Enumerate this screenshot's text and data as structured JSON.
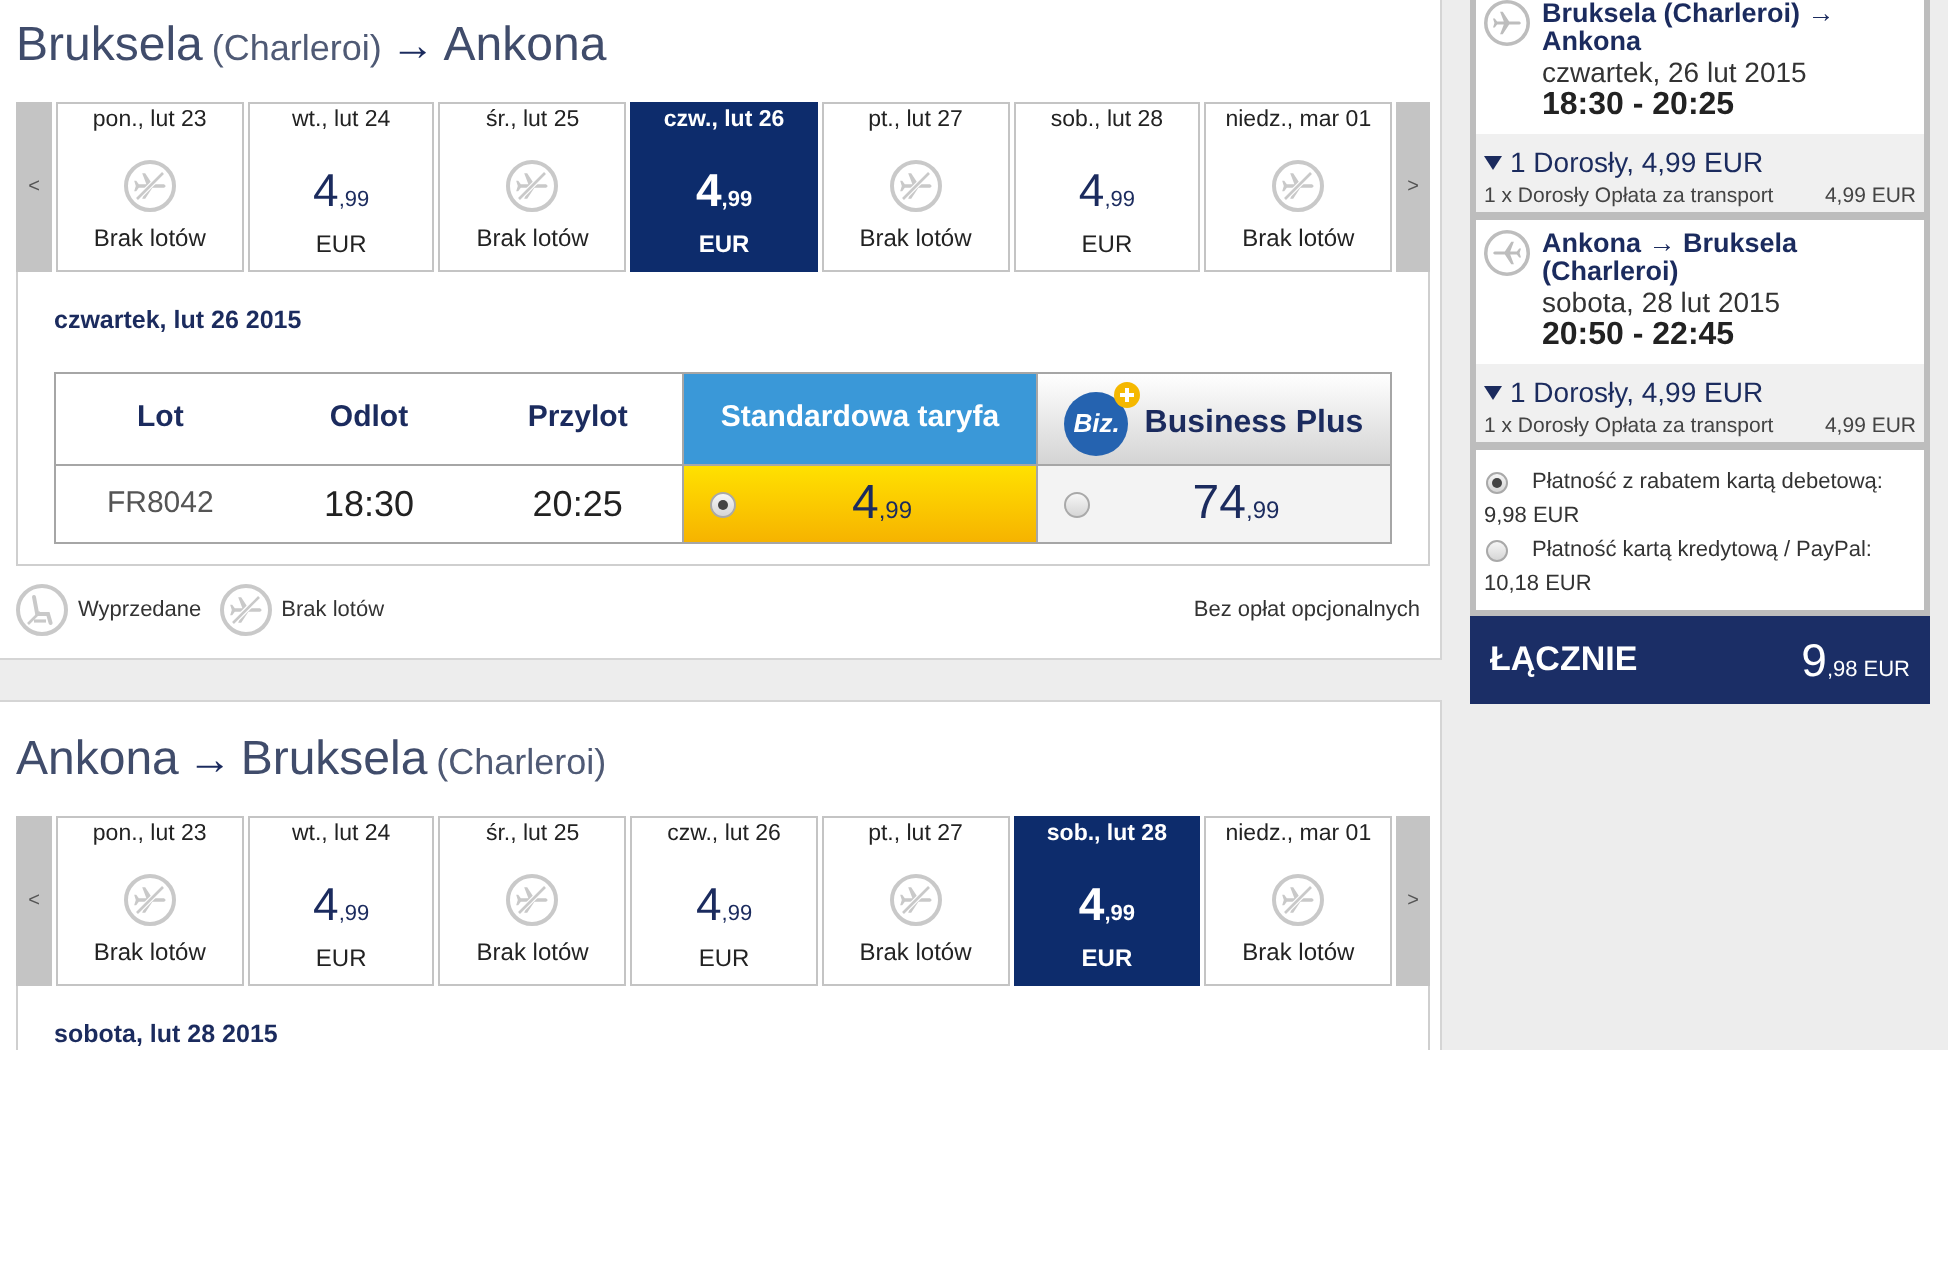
{
  "journeys": [
    {
      "title": [
        {
          "kind": "city",
          "text": "Bruksela"
        },
        {
          "kind": "note",
          "text": "(Charleroi)"
        },
        {
          "kind": "arrow",
          "text": "→"
        },
        {
          "kind": "city",
          "text": "Ankona"
        }
      ],
      "prev_label": "<",
      "next_label": ">",
      "days": [
        {
          "label": "pon., lut 23",
          "kind": "no_flights",
          "status": "Brak lotów",
          "selected": false
        },
        {
          "label": "wt., lut 24",
          "kind": "fare",
          "price": {
            "whole": "4",
            "fraction": ",99"
          },
          "currency": "EUR",
          "selected": false
        },
        {
          "label": "śr., lut 25",
          "kind": "no_flights",
          "status": "Brak lotów",
          "selected": false
        },
        {
          "label": "czw., lut 26",
          "kind": "fare",
          "price": {
            "whole": "4",
            "fraction": ",99"
          },
          "currency": "EUR",
          "selected": true
        },
        {
          "label": "pt., lut 27",
          "kind": "no_flights",
          "status": "Brak lotów",
          "selected": false
        },
        {
          "label": "sob., lut 28",
          "kind": "fare",
          "price": {
            "whole": "4",
            "fraction": ",99"
          },
          "currency": "EUR",
          "selected": false
        },
        {
          "label": "niedz., mar 01",
          "kind": "no_flights",
          "status": "Brak lotów",
          "selected": false
        }
      ],
      "date_heading": "czwartek, lut 26 2015",
      "table": {
        "columns": [
          {
            "kind": "text",
            "label": "Lot"
          },
          {
            "kind": "text",
            "label": "Odlot"
          },
          {
            "kind": "text",
            "label": "Przylot"
          },
          {
            "kind": "standard",
            "label": "Standardowa taryfa"
          },
          {
            "kind": "business",
            "label": "Business Plus",
            "logo": "Biz."
          }
        ],
        "rows": [
          {
            "cells": [
              "FR8042",
              "18:30",
              "20:25"
            ],
            "fares": [
              {
                "whole": "4",
                "fraction": ",99",
                "selected": true
              },
              {
                "whole": "74",
                "fraction": ",99",
                "selected": false
              }
            ]
          }
        ]
      },
      "legend": {
        "items": [
          {
            "kind": "sold_out",
            "label": "Wyprzedane"
          },
          {
            "kind": "no_flights",
            "label": "Brak lotów"
          }
        ],
        "note": "Bez opłat opcjonalnych"
      }
    },
    {
      "title": [
        {
          "kind": "city",
          "text": "Ankona"
        },
        {
          "kind": "arrow",
          "text": "→"
        },
        {
          "kind": "city",
          "text": "Bruksela"
        },
        {
          "kind": "note",
          "text": "(Charleroi)"
        }
      ],
      "prev_label": "<",
      "next_label": ">",
      "days": [
        {
          "label": "pon., lut 23",
          "kind": "no_flights",
          "status": "Brak lotów",
          "selected": false
        },
        {
          "label": "wt., lut 24",
          "kind": "fare",
          "price": {
            "whole": "4",
            "fraction": ",99"
          },
          "currency": "EUR",
          "selected": false
        },
        {
          "label": "śr., lut 25",
          "kind": "no_flights",
          "status": "Brak lotów",
          "selected": false
        },
        {
          "label": "czw., lut 26",
          "kind": "fare",
          "price": {
            "whole": "4",
            "fraction": ",99"
          },
          "currency": "EUR",
          "selected": false
        },
        {
          "label": "pt., lut 27",
          "kind": "no_flights",
          "status": "Brak lotów",
          "selected": false
        },
        {
          "label": "sob., lut 28",
          "kind": "fare",
          "price": {
            "whole": "4",
            "fraction": ",99"
          },
          "currency": "EUR",
          "selected": true
        },
        {
          "label": "niedz., mar 01",
          "kind": "no_flights",
          "status": "Brak lotów",
          "selected": false
        }
      ],
      "date_heading": "sobota, lut 28 2015"
    }
  ],
  "trips": [
    {
      "kind": "outbound",
      "route": "Bruksela (Charleroi) → Ankona",
      "date": "czwartek, 26 lut 2015",
      "times": "18:30 - 20:25",
      "passengers": {
        "summary": "1 Dorosły, 4,99 EUR",
        "expanded": true,
        "items": [
          {
            "label": "1 x Dorosły Opłata za transport",
            "amount": "4,99 EUR"
          }
        ]
      }
    },
    {
      "kind": "return",
      "route": "Ankona → Bruksela (Charleroi)",
      "date": "sobota, 28 lut 2015",
      "times": "20:50 - 22:45",
      "passengers": {
        "summary": "1 Dorosły, 4,99 EUR",
        "expanded": true,
        "items": [
          {
            "label": "1 x Dorosły Opłata za transport",
            "amount": "4,99 EUR"
          }
        ]
      }
    }
  ],
  "payment_options": [
    {
      "label": "Płatność z rabatem kartą debetową:",
      "amount": "9,98 EUR",
      "selected": true
    },
    {
      "label": "Płatność kartą kredytową / PayPal:",
      "amount": "10,18 EUR",
      "selected": false
    }
  ],
  "total": {
    "label": "ŁĄCZNIE",
    "whole": "9",
    "fraction": ",98",
    "currency": "EUR"
  }
}
